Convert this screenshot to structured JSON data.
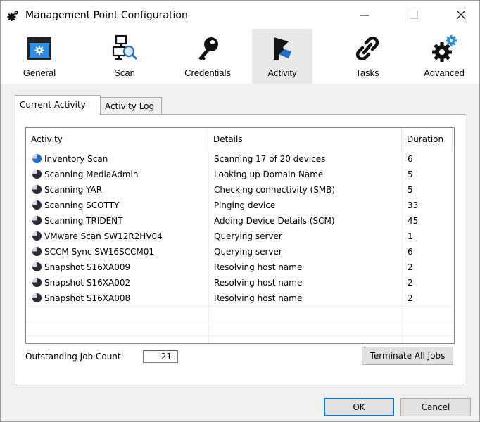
{
  "window": {
    "title": "Management Point Configuration"
  },
  "colors": {
    "pie_blue": "#1f6fc4",
    "pie_dark": "#2b2b3a",
    "accent": "#0078d7"
  },
  "toolbar": {
    "items": [
      {
        "label": "General",
        "icon": "general-window-icon"
      },
      {
        "label": "Scan",
        "icon": "scan-computers-icon"
      },
      {
        "label": "Credentials",
        "icon": "key-icon"
      },
      {
        "label": "Activity",
        "icon": "activity-flag-icon"
      },
      {
        "label": "Tasks",
        "icon": "chain-link-icon"
      },
      {
        "label": "Advanced",
        "icon": "gears-icon"
      }
    ]
  },
  "tabs": [
    {
      "label": "Current Activity"
    },
    {
      "label": "Activity Log"
    }
  ],
  "list": {
    "columns": {
      "activity": "Activity",
      "details": "Details",
      "duration": "Duration"
    },
    "rows": [
      {
        "activity": "Inventory Scan",
        "details": "Scanning 17 of 20 devices",
        "duration": "6",
        "icon": "progress-pie-blue-icon"
      },
      {
        "activity": "Scanning MediaAdmin",
        "details": "Looking up Domain Name",
        "duration": "5",
        "icon": "progress-pie-icon"
      },
      {
        "activity": "Scanning YAR",
        "details": "Checking connectivity (SMB)",
        "duration": "5",
        "icon": "progress-pie-icon"
      },
      {
        "activity": "Scanning SCOTTY",
        "details": "Pinging device",
        "duration": "33",
        "icon": "progress-pie-icon"
      },
      {
        "activity": "Scanning TRIDENT",
        "details": "Adding Device Details (SCM)",
        "duration": "45",
        "icon": "progress-pie-icon"
      },
      {
        "activity": "VMware Scan SW12R2HV04",
        "details": "Querying server",
        "duration": "1",
        "icon": "progress-pie-icon"
      },
      {
        "activity": "SCCM Sync SW16SCCM01",
        "details": "Querying server",
        "duration": "6",
        "icon": "progress-pie-icon"
      },
      {
        "activity": "Snapshot S16XA009",
        "details": "Resolving host name",
        "duration": "2",
        "icon": "progress-pie-icon"
      },
      {
        "activity": "Snapshot S16XA002",
        "details": "Resolving host name",
        "duration": "2",
        "icon": "progress-pie-icon"
      },
      {
        "activity": "Snapshot S16XA008",
        "details": "Resolving host name",
        "duration": "2",
        "icon": "progress-pie-icon"
      }
    ]
  },
  "footer": {
    "outstanding_label": "Outstanding Job Count:",
    "outstanding_value": "21",
    "terminate_label": "Terminate All Jobs"
  },
  "buttons": {
    "ok": "OK",
    "cancel": "Cancel"
  }
}
